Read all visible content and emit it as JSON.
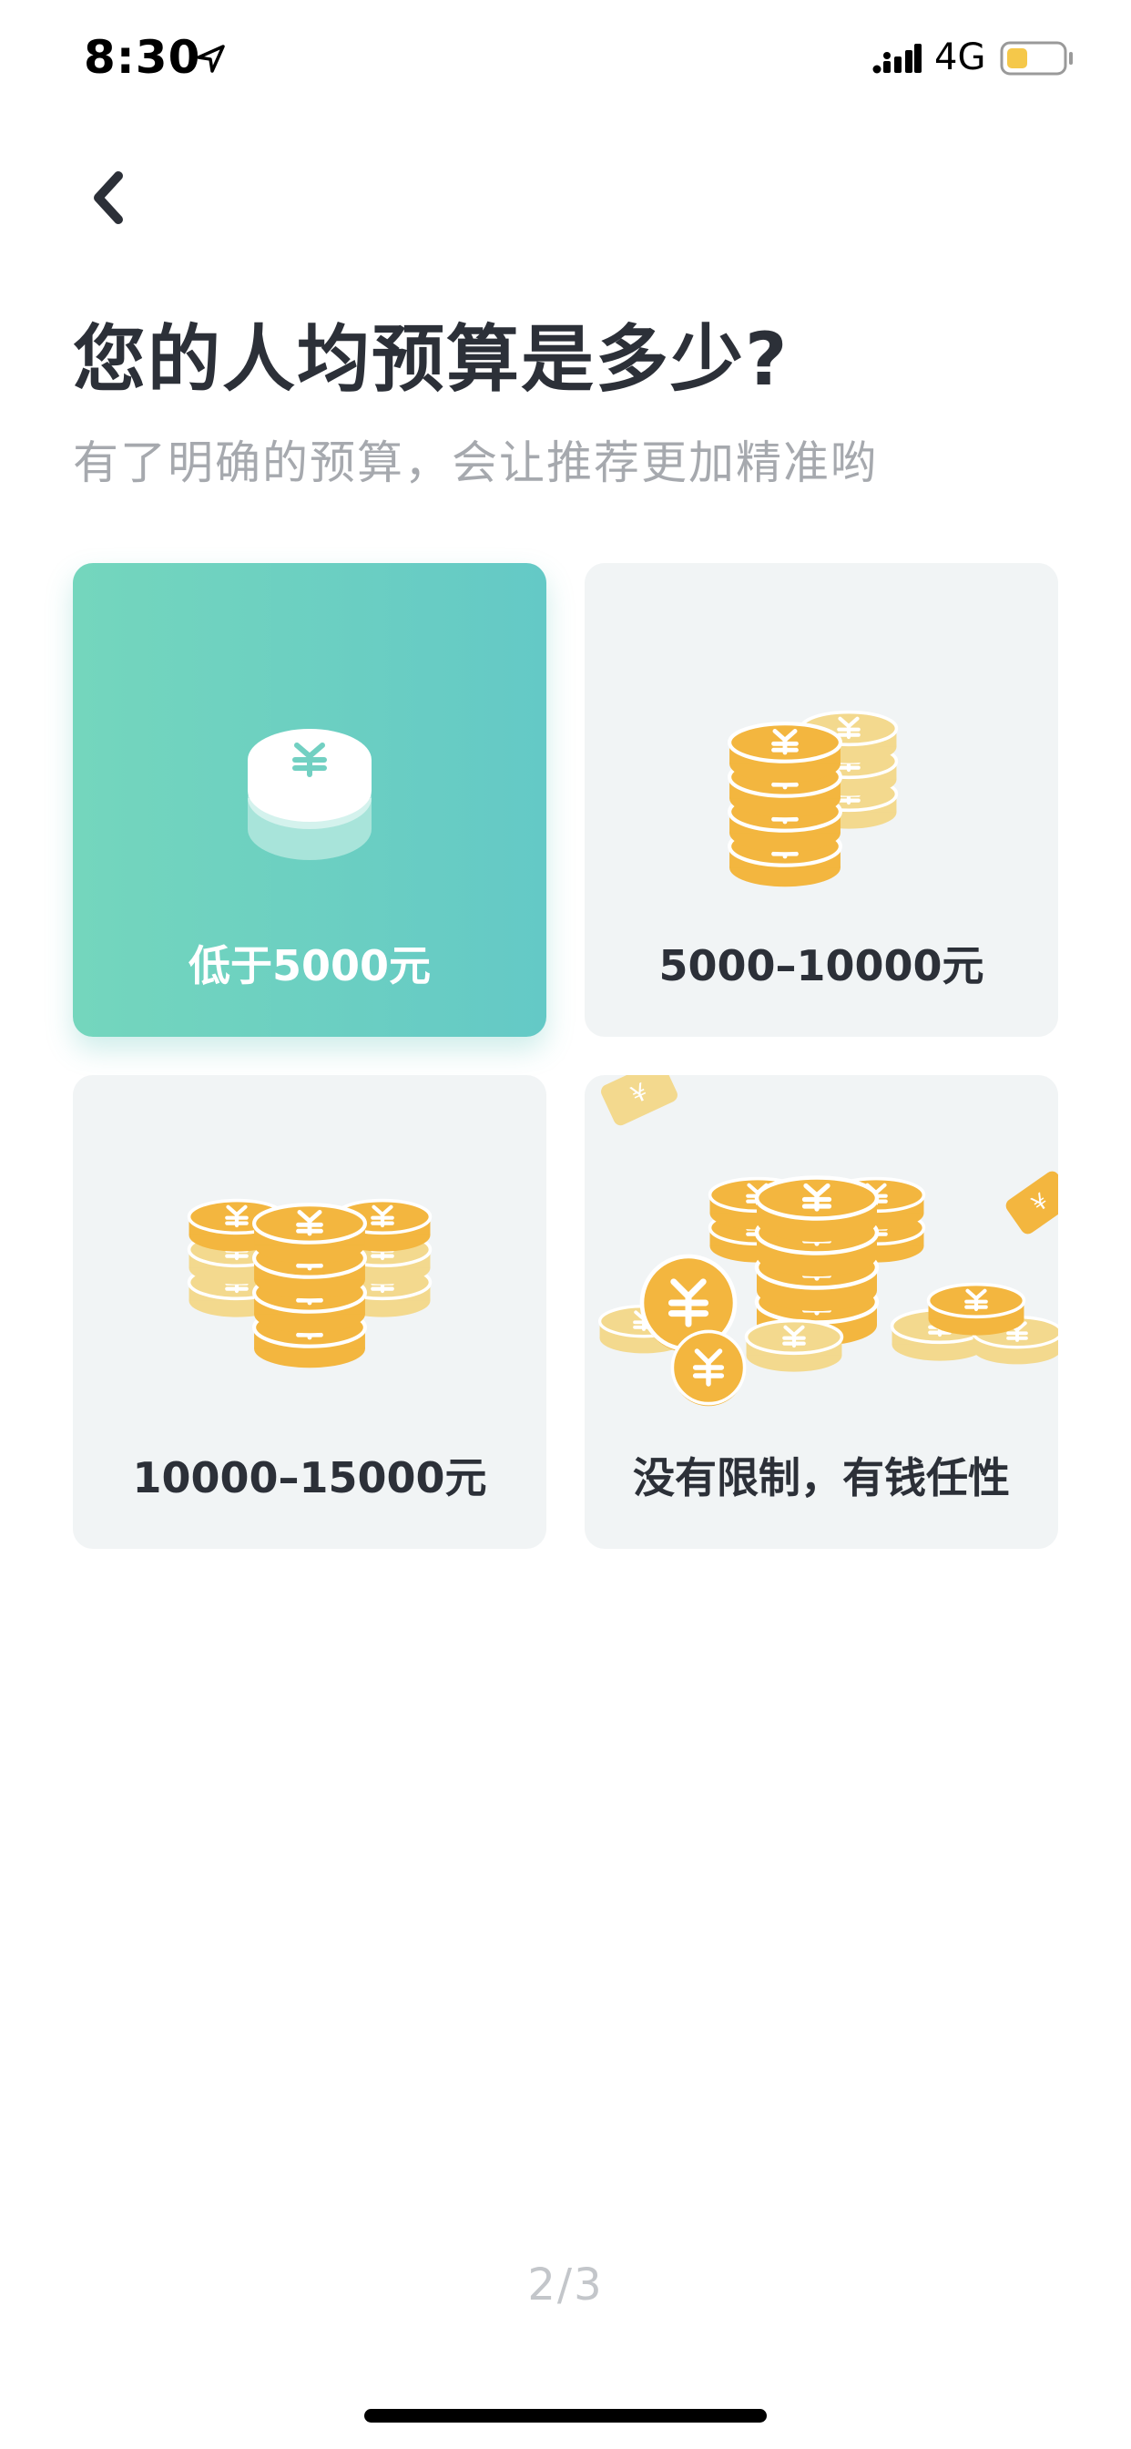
{
  "status_bar": {
    "time": "8:30",
    "network": "4G",
    "icons": [
      "location-arrow-icon",
      "cellular-signal-icon",
      "battery-icon"
    ],
    "battery_color": "#f5c84a"
  },
  "navigation": {
    "back_icon": "chevron-left-icon"
  },
  "header": {
    "title": "您的人均预算是多少?",
    "subtitle": "有了明确的预算，会让推荐更加精准哟"
  },
  "options": [
    {
      "label": "低于5000元",
      "selected": true,
      "icon": "single-coin-icon"
    },
    {
      "label": "5000–10000元",
      "selected": false,
      "icon": "coin-stacks-icon"
    },
    {
      "label": "10000–15000元",
      "selected": false,
      "icon": "coin-piles-icon"
    },
    {
      "label": "没有限制，有钱任性",
      "selected": false,
      "icon": "coin-heap-icon"
    }
  ],
  "pagination": {
    "label": "2/3"
  },
  "colors": {
    "accent_start": "#74d6bd",
    "accent_end": "#64c9c6",
    "card_background": "#f1f4f5",
    "coin_gold": "#f3b63f",
    "coin_pale": "#f3d98e",
    "title_text": "#2c3038",
    "subtitle_text": "#a6a9ae"
  }
}
